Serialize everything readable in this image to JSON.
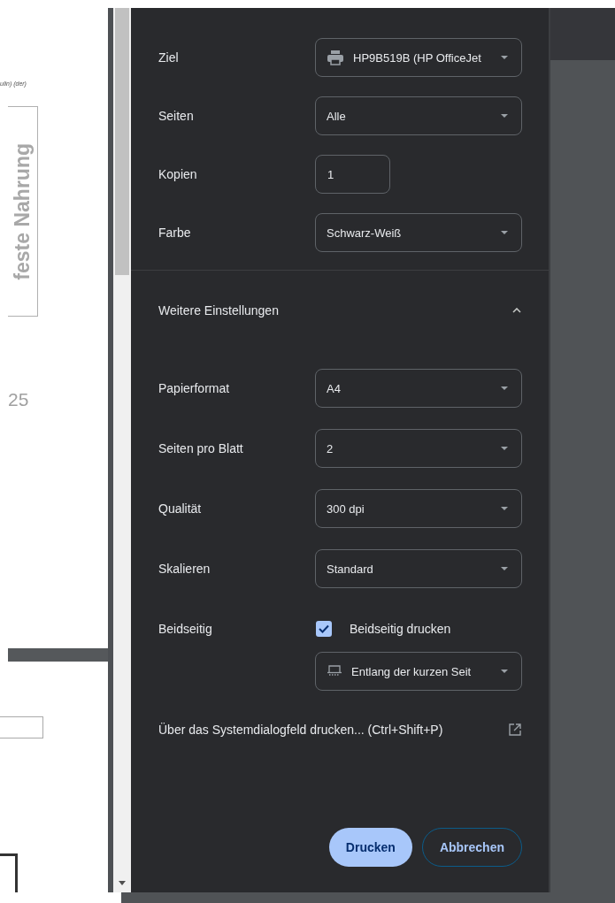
{
  "preview": {
    "header_fragment": "ulin) (der)",
    "vertical_label": "feste Nahrung",
    "page_number": "25"
  },
  "settings": [
    {
      "label": "Ziel",
      "kind": "destination",
      "value": "HP9B519B (HP OfficeJet"
    },
    {
      "label": "Seiten",
      "kind": "select",
      "value": "Alle"
    },
    {
      "label": "Kopien",
      "kind": "number",
      "value": "1"
    },
    {
      "label": "Farbe",
      "kind": "select",
      "value": "Schwarz-Weiß"
    }
  ],
  "more_settings": {
    "label": "Weitere Einstellungen",
    "expanded": true,
    "settings": [
      {
        "label": "Papierformat",
        "kind": "select",
        "value": "A4"
      },
      {
        "label": "Seiten pro Blatt",
        "kind": "select",
        "value": "2"
      },
      {
        "label": "Qualität",
        "kind": "select",
        "value": "300 dpi"
      },
      {
        "label": "Skalieren",
        "kind": "select",
        "value": "Standard"
      },
      {
        "label": "Beidseitig",
        "kind": "duplex",
        "checked": true,
        "checkbox_label": "Beidseitig drucken",
        "value": "Entlang der kurzen Seit"
      }
    ]
  },
  "system_dialog_link": "Über das Systemdialogfeld drucken... (Ctrl+Shift+P)",
  "buttons": [
    {
      "label": "Drucken",
      "kind": "primary"
    },
    {
      "label": "Abbrechen",
      "kind": "secondary"
    }
  ]
}
